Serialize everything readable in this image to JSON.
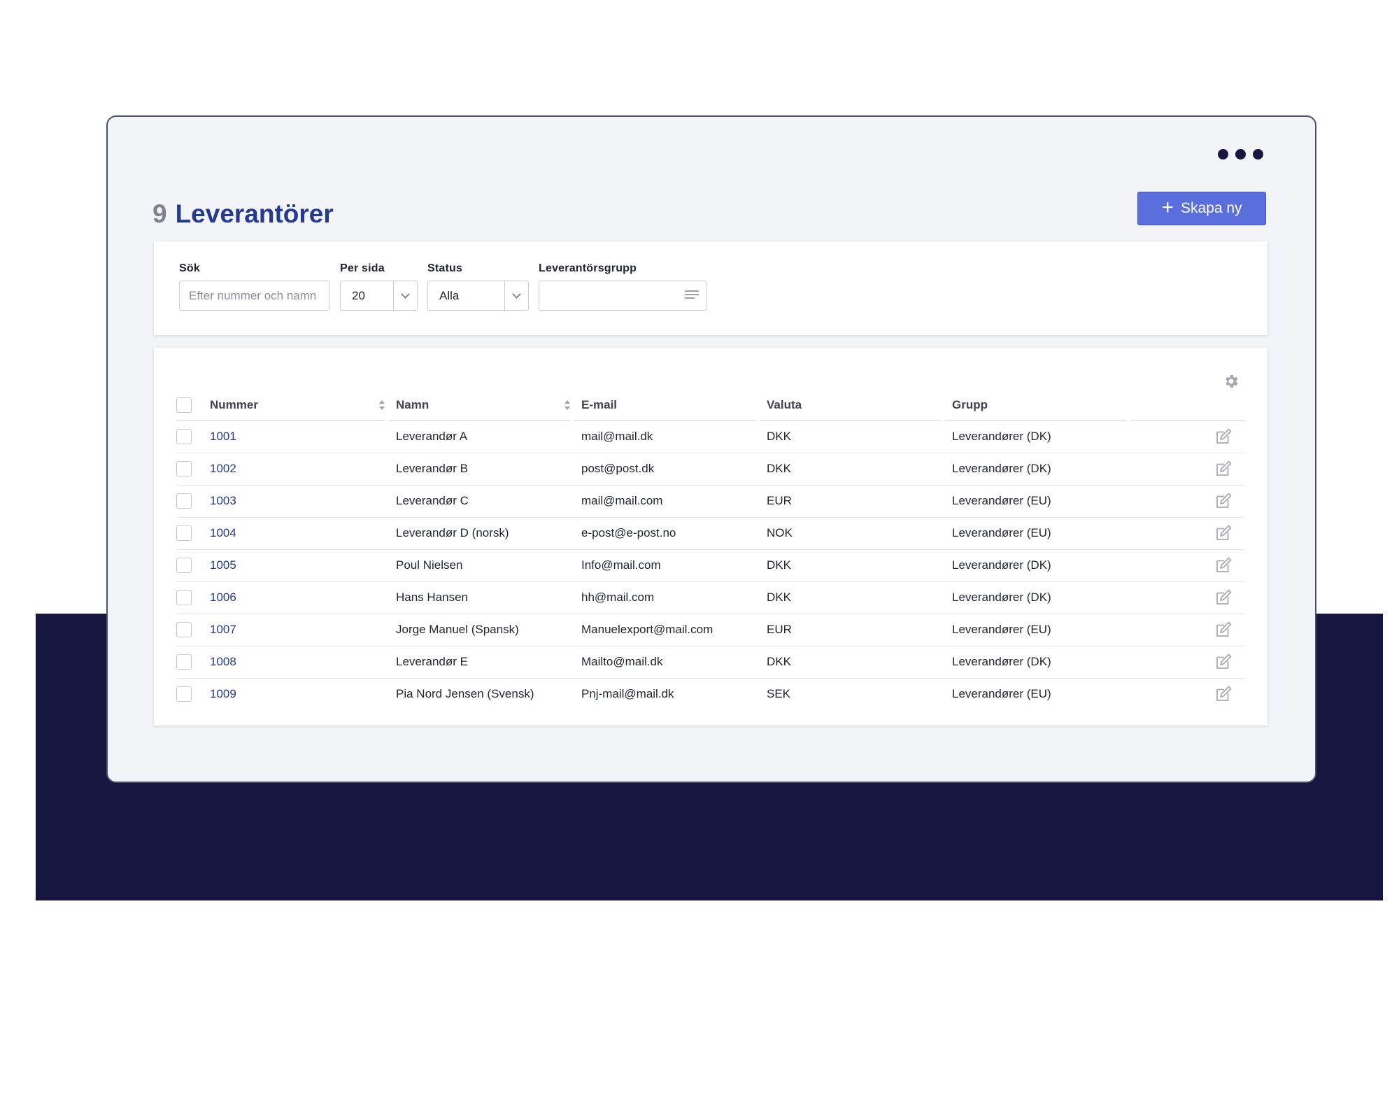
{
  "page": {
    "count": "9",
    "title": "Leverantörer",
    "create_button": "Skapa ny"
  },
  "colors": {
    "navy": "#171640",
    "accent": "#5b6fdc",
    "title": "#243a8f",
    "window_bg": "#f3f4f8"
  },
  "filters": {
    "search": {
      "label": "Sök",
      "placeholder": "Efter nummer och namn",
      "value": ""
    },
    "per_page": {
      "label": "Per sida",
      "value": "20"
    },
    "status": {
      "label": "Status",
      "value": "Alla"
    },
    "supplier_group": {
      "label": "Leverantörsgrupp",
      "value": ""
    }
  },
  "table": {
    "columns": {
      "number": "Nummer",
      "name": "Namn",
      "email": "E-mail",
      "currency": "Valuta",
      "group": "Grupp"
    },
    "rows": [
      {
        "number": "1001",
        "name": "Leverandør A",
        "email": "mail@mail.dk",
        "currency": "DKK",
        "group": "Leverandører (DK)"
      },
      {
        "number": "1002",
        "name": "Leverandør B",
        "email": "post@post.dk",
        "currency": "DKK",
        "group": "Leverandører (DK)"
      },
      {
        "number": "1003",
        "name": "Leverandør C",
        "email": "mail@mail.com",
        "currency": "EUR",
        "group": "Leverandører (EU)"
      },
      {
        "number": "1004",
        "name": "Leverandør D (norsk)",
        "email": "e-post@e-post.no",
        "currency": "NOK",
        "group": "Leverandører (EU)"
      },
      {
        "number": "1005",
        "name": "Poul Nielsen",
        "email": "Info@mail.com",
        "currency": "DKK",
        "group": "Leverandører (DK)"
      },
      {
        "number": "1006",
        "name": "Hans Hansen",
        "email": "hh@mail.com",
        "currency": "DKK",
        "group": "Leverandører (DK)"
      },
      {
        "number": "1007",
        "name": "Jorge Manuel (Spansk)",
        "email": "Manuelexport@mail.com",
        "currency": "EUR",
        "group": "Leverandører (EU)"
      },
      {
        "number": "1008",
        "name": "Leverandør E",
        "email": "Mailto@mail.dk",
        "currency": "DKK",
        "group": "Leverandører (DK)"
      },
      {
        "number": "1009",
        "name": "Pia Nord Jensen (Svensk)",
        "email": "Pnj-mail@mail.dk",
        "currency": "SEK",
        "group": "Leverandører (EU)"
      }
    ]
  }
}
